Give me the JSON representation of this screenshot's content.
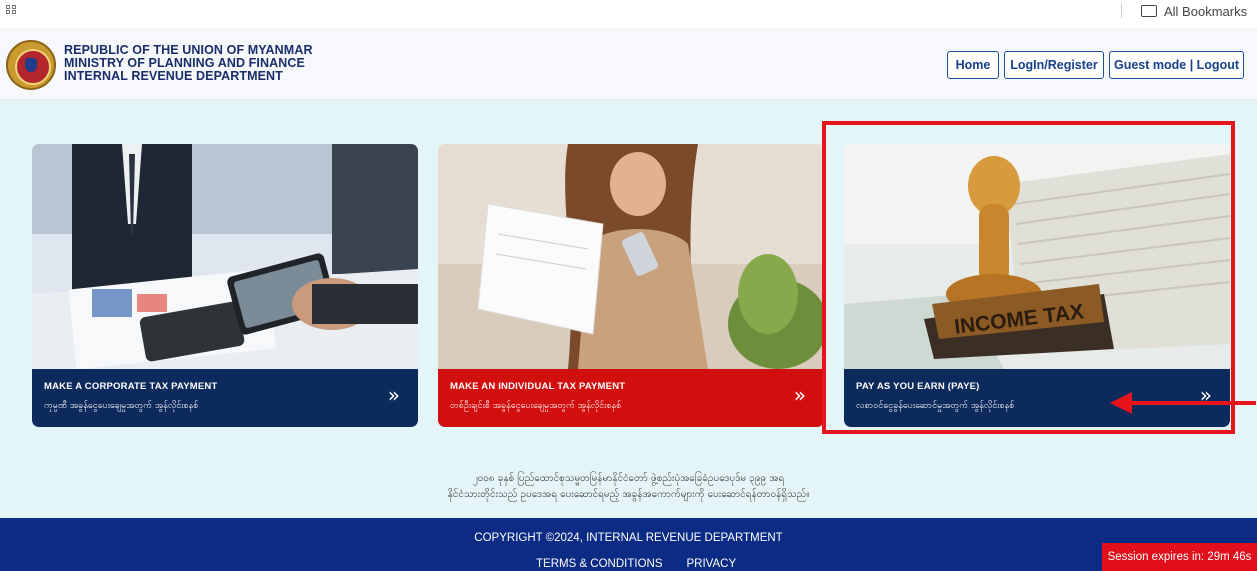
{
  "browser": {
    "bookmarks_label": "All Bookmarks"
  },
  "header": {
    "org_line1": "REPUBLIC OF THE UNION OF MYANMAR",
    "org_line2": "MINISTRY OF PLANNING AND FINANCE",
    "org_line3": "INTERNAL REVENUE DEPARTMENT",
    "nav": {
      "home": "Home",
      "login": "LogIn/Register",
      "guest": "Guest mode | Logout"
    }
  },
  "cards": [
    {
      "title": "MAKE A CORPORATE TAX PAYMENT",
      "subtitle": "ကုမ္ပဏီ အခွန်ငွေပေးချေမှုအတွက် အွန်လိုင်းစနစ်",
      "band_color": "#0d2a5c"
    },
    {
      "title": "MAKE AN INDIVIDUAL TAX PAYMENT",
      "subtitle": "တစ်ဦးချင်းစီ အခွန်ငွေပေးချေမှုအတွက် အွန်လိုင်းစနစ်",
      "band_color": "#d10f0f"
    },
    {
      "title": "PAY AS YOU EARN (PAYE)",
      "subtitle": "လစာဝင်ငွေခွန်ပေးဆောင်မှုအတွက် အွန်လိုင်းစနစ်",
      "band_color": "#0d2a5c",
      "stamp_text": "INCOME TAX"
    }
  ],
  "notice": {
    "line1": "၂၀၀၈ ခုနှစ် ပြည်ထောင်စုသမ္မတမြန်မာနိုင်ငံတော် ဖွဲ့စည်းပုံအခြေခံဥပဒေပုဒ်မ ၃၉၉ အရ",
    "line2": "နိုင်ငံသားတိုင်းသည် ဥပဒေအရ ပေးဆောင်ရမည့် အခွန်အကောက်များကို ပေးဆောင်ရန်တာဝန်ရှိသည်။"
  },
  "footer": {
    "copyright": "COPYRIGHT ©2024, INTERNAL REVENUE DEPARTMENT",
    "terms": "TERMS & CONDITIONS",
    "privacy": "PRIVACY",
    "session": "Session expires in: 29m 46s"
  },
  "colors": {
    "navy": "#0b2b85",
    "red": "#e10f1c",
    "highlight": "#e8141b"
  }
}
